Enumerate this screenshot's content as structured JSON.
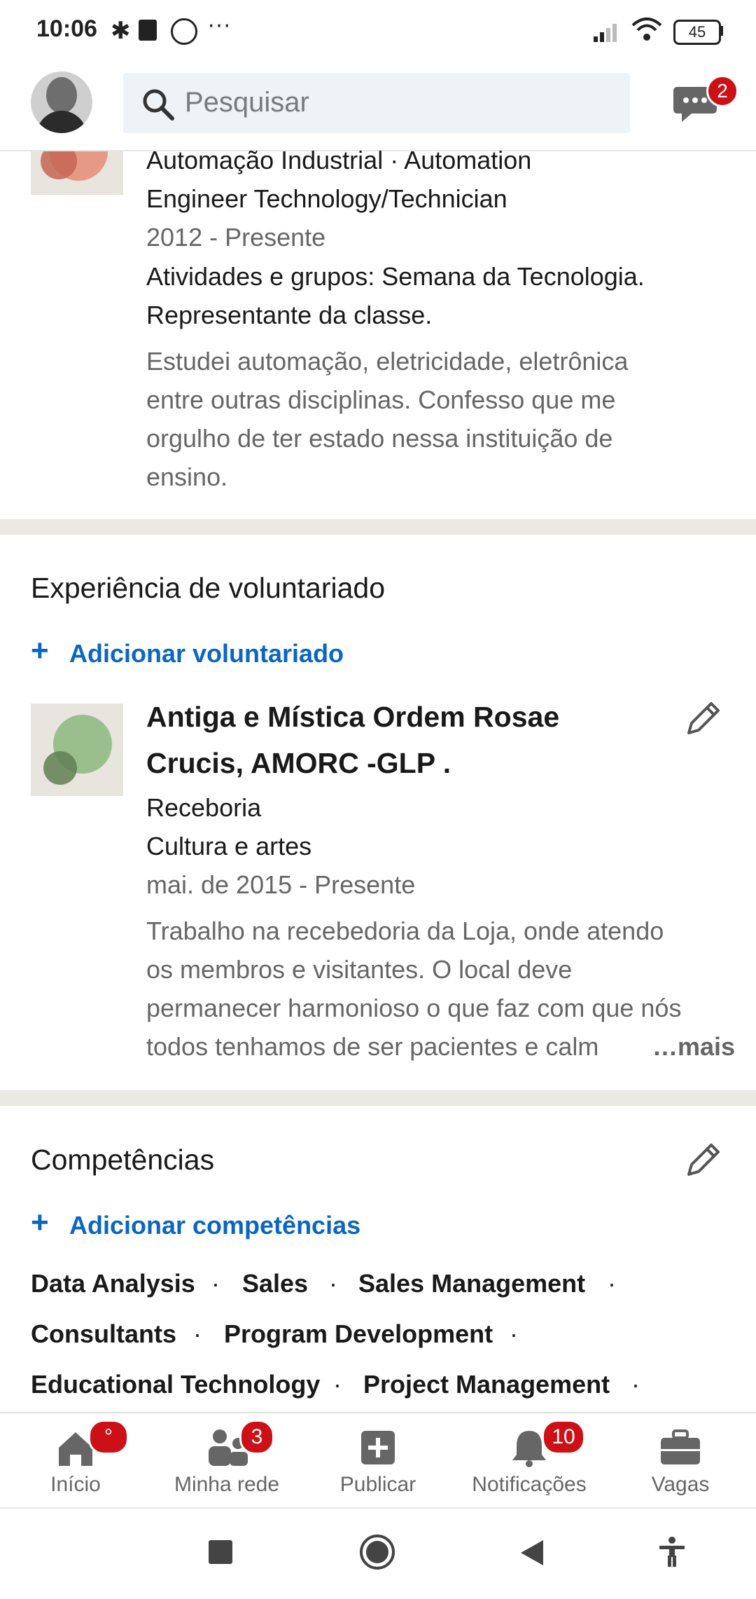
{
  "status": {
    "time": "10:06",
    "battery": "45"
  },
  "search": {
    "placeholder": "Pesquisar"
  },
  "messages": {
    "badge": "2"
  },
  "education": {
    "field_line1": "Automação Industrial  ·  Automation",
    "field_line2": "Engineer Technology/Technician",
    "dates": "2012 - Presente",
    "activities_line1": "Atividades e grupos: Semana da Tecnologia.",
    "activities_line2": "Representante da classe.",
    "desc_line1": "Estudei automação, eletricidade, eletrônica",
    "desc_line2": "entre outras disciplinas. Confesso que me",
    "desc_line3": "orgulho de ter estado nessa instituição de",
    "desc_line4": "ensino."
  },
  "volunteer": {
    "heading": "Experiência de voluntariado",
    "add_label": "Adicionar voluntariado",
    "org_line1": "Antiga e Mística Ordem Rosae",
    "org_line2": "Crucis, AMORC -GLP .",
    "role": "Receboria",
    "cause": "Cultura e artes",
    "dates": "mai. de 2015 - Presente",
    "desc_line1": "Trabalho na recebedoria da Loja, onde atendo",
    "desc_line2": "os membros e visitantes. O local deve",
    "desc_line3": "permanecer harmonioso o que faz com que nós",
    "desc_line4": "todos tenhamos de ser pacientes e calm",
    "more": "…mais"
  },
  "skills": {
    "heading": "Competências",
    "add_label": "Adicionar competências",
    "items": [
      "Data Analysis",
      "Sales",
      "Sales Management",
      "Consultants",
      "Program Development",
      "Educational Technology",
      "Project Management"
    ]
  },
  "nav": {
    "items": [
      {
        "label": "Início",
        "badge": "°"
      },
      {
        "label": "Minha rede",
        "badge": "3"
      },
      {
        "label": "Publicar",
        "badge": ""
      },
      {
        "label": "Notificações",
        "badge": "10"
      },
      {
        "label": "Vagas",
        "badge": ""
      }
    ]
  },
  "colors": {
    "accent": "#0a66c2",
    "badge": "#cc1016",
    "separator": "#ebe9e4"
  }
}
